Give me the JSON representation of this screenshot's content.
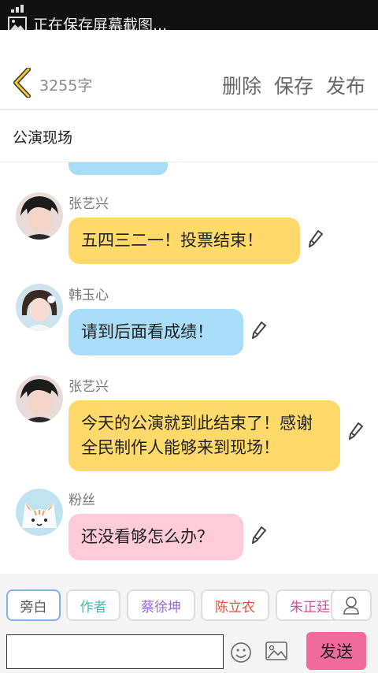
{
  "status": {
    "notification": "正在保存屏幕截图..."
  },
  "header": {
    "word_count": "3255字",
    "delete_label": "删除",
    "save_label": "保存",
    "publish_label": "发布"
  },
  "title": "公演现场",
  "messages": [
    {
      "name": "张艺兴",
      "text": "五四三二一！投票结束！",
      "color": "#ffd96a"
    },
    {
      "name": "韩玉心",
      "text": "请到后面看成绩！",
      "color": "#a9dcf7"
    },
    {
      "name": "张艺兴",
      "text": "今天的公演就到此结束了！感谢全民制作人能够来到现场！",
      "color": "#ffd96a"
    },
    {
      "name": "粉丝",
      "text": "还没看够怎么办？",
      "color": "#ffcbd8"
    }
  ],
  "roles": [
    {
      "label": "旁白",
      "color": "#555555"
    },
    {
      "label": "作者",
      "color": "#3bbfb3"
    },
    {
      "label": "蔡徐坤",
      "color": "#9a6ad0"
    },
    {
      "label": "陈立农",
      "color": "#e0503a"
    },
    {
      "label": "朱正廷",
      "color": "#e04a9a"
    }
  ],
  "input": {
    "placeholder": ""
  },
  "send_label": "发送"
}
